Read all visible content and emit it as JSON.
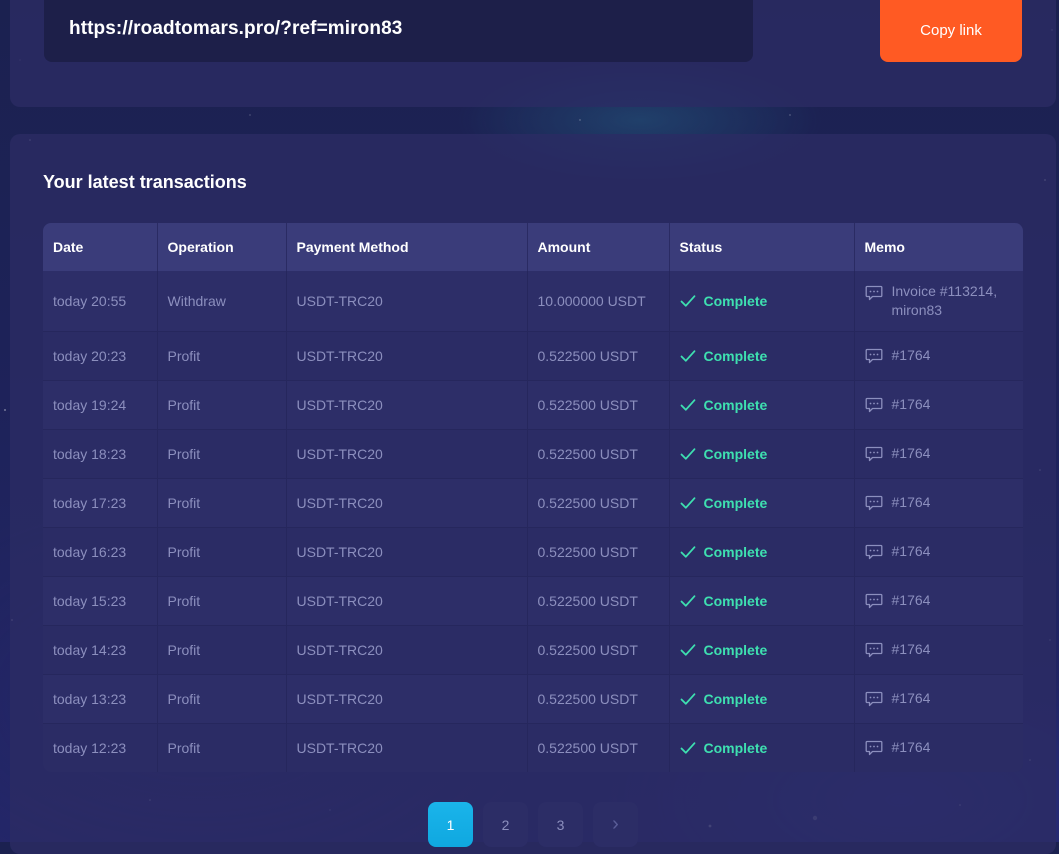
{
  "referral": {
    "link": "https://roadtomars.pro/?ref=miron83",
    "copy_label": "Copy link"
  },
  "transactions": {
    "title": "Your latest transactions",
    "columns": [
      "Date",
      "Operation",
      "Payment Method",
      "Amount",
      "Status",
      "Memo"
    ],
    "rows": [
      {
        "date": "today 20:55",
        "operation": "Withdraw",
        "method": "USDT-TRC20",
        "amount": "10.000000 USDT",
        "status": "Complete",
        "memo": "Invoice #113214, miron83"
      },
      {
        "date": "today 20:23",
        "operation": "Profit",
        "method": "USDT-TRC20",
        "amount": "0.522500 USDT",
        "status": "Complete",
        "memo": "#1764"
      },
      {
        "date": "today 19:24",
        "operation": "Profit",
        "method": "USDT-TRC20",
        "amount": "0.522500 USDT",
        "status": "Complete",
        "memo": "#1764"
      },
      {
        "date": "today 18:23",
        "operation": "Profit",
        "method": "USDT-TRC20",
        "amount": "0.522500 USDT",
        "status": "Complete",
        "memo": "#1764"
      },
      {
        "date": "today 17:23",
        "operation": "Profit",
        "method": "USDT-TRC20",
        "amount": "0.522500 USDT",
        "status": "Complete",
        "memo": "#1764"
      },
      {
        "date": "today 16:23",
        "operation": "Profit",
        "method": "USDT-TRC20",
        "amount": "0.522500 USDT",
        "status": "Complete",
        "memo": "#1764"
      },
      {
        "date": "today 15:23",
        "operation": "Profit",
        "method": "USDT-TRC20",
        "amount": "0.522500 USDT",
        "status": "Complete",
        "memo": "#1764"
      },
      {
        "date": "today 14:23",
        "operation": "Profit",
        "method": "USDT-TRC20",
        "amount": "0.522500 USDT",
        "status": "Complete",
        "memo": "#1764"
      },
      {
        "date": "today 13:23",
        "operation": "Profit",
        "method": "USDT-TRC20",
        "amount": "0.522500 USDT",
        "status": "Complete",
        "memo": "#1764"
      },
      {
        "date": "today 12:23",
        "operation": "Profit",
        "method": "USDT-TRC20",
        "amount": "0.522500 USDT",
        "status": "Complete",
        "memo": "#1764"
      }
    ]
  },
  "pagination": {
    "pages": [
      "1",
      "2",
      "3"
    ],
    "current": "1",
    "next_icon": "chevron-right-icon",
    "next_glyph": "›"
  },
  "icons": {
    "status": "check-icon",
    "memo": "comment-icon"
  },
  "colors": {
    "accent": "#ff5a23",
    "status_complete": "#3ee0b0",
    "page_active": "#1ab4ea"
  }
}
